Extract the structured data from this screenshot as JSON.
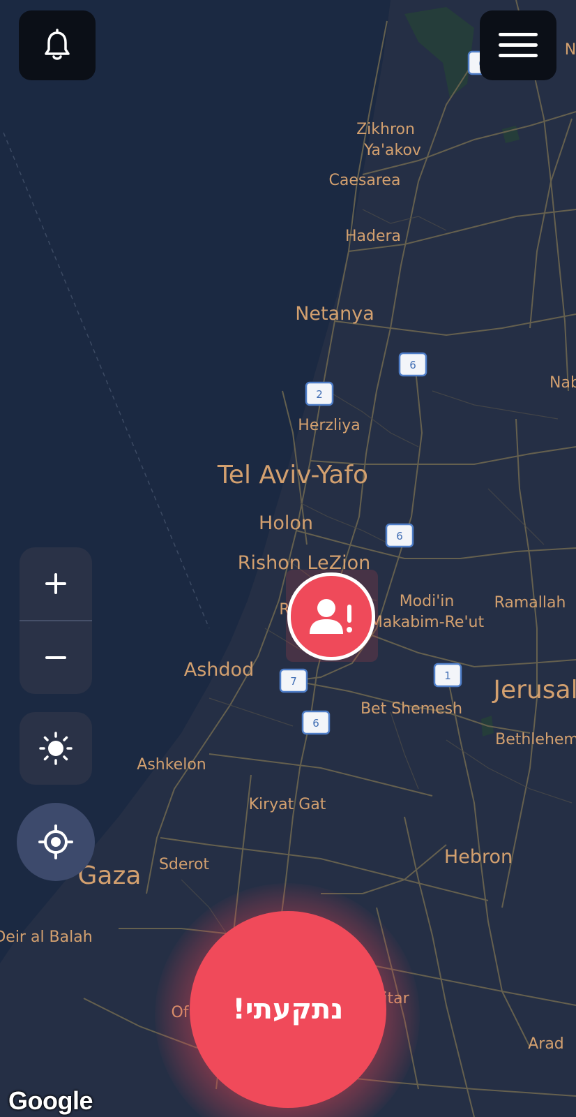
{
  "map": {
    "cities": [
      {
        "name": "Zikhron",
        "size": "s"
      },
      {
        "name": "Ya'akov",
        "size": "s"
      },
      {
        "name": "Caesarea",
        "size": "s"
      },
      {
        "name": "Hadera",
        "size": "s"
      },
      {
        "name": "Netanya",
        "size": "m"
      },
      {
        "name": "Herzliya",
        "size": "s"
      },
      {
        "name": "Tel Aviv-Yafo",
        "size": "l"
      },
      {
        "name": "Holon",
        "size": "m"
      },
      {
        "name": "Rishon LeZion",
        "size": "m"
      },
      {
        "name": "Modi'in",
        "size": "s"
      },
      {
        "name": "Makabim-Re'ut",
        "size": "s"
      },
      {
        "name": "Ramallah",
        "size": "s"
      },
      {
        "name": "Ashdod",
        "size": "m"
      },
      {
        "name": "Jerusal",
        "size": "l"
      },
      {
        "name": "Bet Shemesh",
        "size": "s"
      },
      {
        "name": "Bethlehem",
        "size": "s"
      },
      {
        "name": "Ashkelon",
        "size": "s"
      },
      {
        "name": "Kiryat Gat",
        "size": "s"
      },
      {
        "name": "Gaza",
        "size": "l"
      },
      {
        "name": "Sderot",
        "size": "s"
      },
      {
        "name": "Hebron",
        "size": "m"
      },
      {
        "name": "Deir al Balah",
        "size": "s"
      },
      {
        "name": "Arad",
        "size": "s"
      },
      {
        "name": "Nab",
        "size": "s"
      },
      {
        "name": "itar",
        "size": "s"
      },
      {
        "name": "Of",
        "size": "s"
      },
      {
        "name": "R",
        "size": "s"
      },
      {
        "name": "N",
        "size": "s"
      }
    ],
    "highway_shields": [
      "6",
      "6",
      "2",
      "6",
      "7",
      "1",
      "6"
    ],
    "attribution": "Google",
    "colors": {
      "sea": "#1b2942",
      "land": "#252f45",
      "roads": "#6b6552",
      "labels": "#d3a06f"
    }
  },
  "controls": {
    "notifications_icon": "bell-icon",
    "menu_icon": "hamburger-menu-icon",
    "zoom_in_label": "+",
    "zoom_out_label": "−",
    "theme_icon": "sun-icon",
    "locate_icon": "crosshair-icon"
  },
  "user_marker": {
    "icon": "user-alert-icon",
    "color": "#ef4a5a"
  },
  "sos_button": {
    "label": "נתקעתי!",
    "color": "#f04a5a"
  }
}
